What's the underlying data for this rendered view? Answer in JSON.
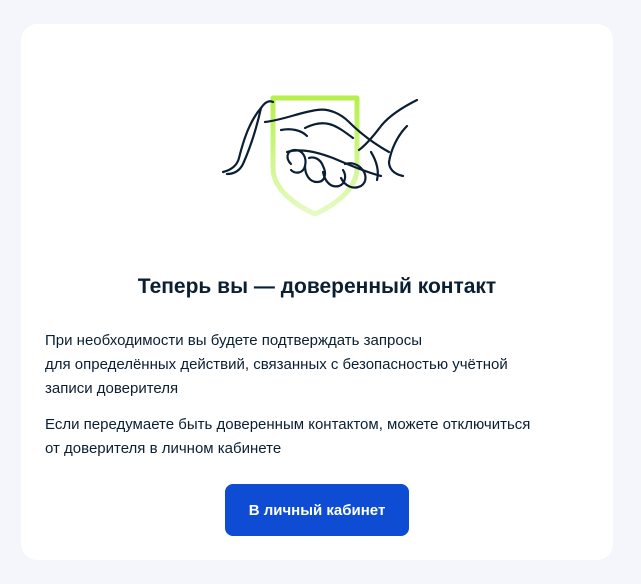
{
  "card": {
    "illustration_icon": "handshake-shield-icon",
    "title": "Теперь вы — доверенный контакт",
    "paragraph1_lines": [
      "При необходимости вы будете подтверждать запросы",
      "для определённых действий, связанных с безопасностью учётной",
      "записи доверителя"
    ],
    "paragraph2_lines": [
      "Если передумаете быть доверенным контактом, можете отключиться",
      "от доверителя в личном кабинете"
    ],
    "button_label": "В личный кабинет"
  },
  "colors": {
    "page_background": "#f4f6fb",
    "card_background": "#ffffff",
    "text": "#0b1f33",
    "primary_button": "#0d4cd3",
    "shield_gradient_top": "#b6f04a",
    "shield_gradient_bottom": "#e6fbc4"
  }
}
